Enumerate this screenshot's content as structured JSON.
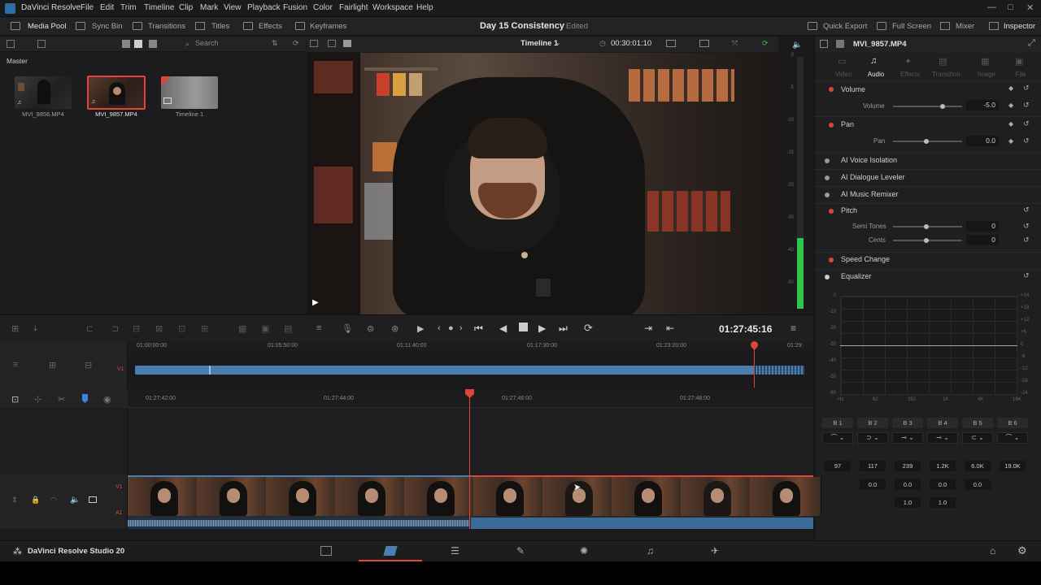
{
  "app": {
    "title": "DaVinci Resolve",
    "brand": "DaVinci Resolve Studio 20"
  },
  "menu": [
    "File",
    "Edit",
    "Trim",
    "Timeline",
    "Clip",
    "Mark",
    "View",
    "Playback",
    "Fusion",
    "Color",
    "Fairlight",
    "Workspace",
    "Help"
  ],
  "toolbar": {
    "left": [
      "Media Pool",
      "Sync Bin",
      "Transitions",
      "Titles",
      "Effects",
      "Keyframes"
    ],
    "project_title": "Day 15 Consistency",
    "project_status": "Edited",
    "right": [
      "Quick Export",
      "Full Screen",
      "Mixer",
      "Inspector"
    ]
  },
  "media_pool": {
    "search_placeholder": "Search",
    "bin": "Master",
    "clips": [
      "MVI_9856.MP4",
      "MVI_9857.MP4",
      "Timeline 1"
    ]
  },
  "viewer": {
    "timeline_name": "Timeline 1",
    "duration": "00:30:01:10",
    "timecode": "01:27:45:16"
  },
  "meter": {
    "scale": [
      "0",
      "-5",
      "-10",
      "-15",
      "-20",
      "-30",
      "-40",
      "-50"
    ],
    "level_pct": 28
  },
  "inspector": {
    "clip_name": "MVI_9857.MP4",
    "tabs": [
      "Video",
      "Audio",
      "Effects",
      "Transition",
      "Image",
      "File"
    ],
    "active_tab": "Audio",
    "sections": {
      "volume": {
        "title": "Volume",
        "label": "Volume",
        "value": "-5.0"
      },
      "pan": {
        "title": "Pan",
        "label": "Pan",
        "value": "0.0"
      },
      "ai_voice": "AI Voice Isolation",
      "ai_dialogue": "AI Dialogue Leveler",
      "ai_music": "AI Music Remixer",
      "pitch": {
        "title": "Pitch",
        "semi_label": "Semi Tones",
        "semi_value": "0",
        "cents_label": "Cents",
        "cents_value": "0"
      },
      "speed": "Speed Change",
      "equalizer": "Equalizer"
    },
    "eq": {
      "left_scale": [
        "0",
        "-10",
        "-20",
        "-30",
        "-40",
        "-50",
        "-60"
      ],
      "right_scale": [
        "+24",
        "+18",
        "+12",
        "+6",
        "0",
        "-6",
        "-12",
        "-18",
        "-24"
      ],
      "freq_labels": [
        "Hz",
        "62",
        "250",
        "1K",
        "4K",
        "16K"
      ],
      "bands": [
        "B 1",
        "B 2",
        "B 3",
        "B 4",
        "B 5",
        "B 6"
      ],
      "freqs": [
        "97",
        "117",
        "239",
        "1.2K",
        "6.0K",
        "19.0K"
      ],
      "gains": [
        "",
        "0.0",
        "0.0",
        "0.0",
        "0.0",
        ""
      ],
      "q": [
        "",
        "",
        "1.0",
        "1.0",
        "",
        ""
      ]
    }
  },
  "timeline": {
    "upper_ruler": [
      "01:00:00:00",
      "01:05:50:00",
      "01:11:40:00",
      "01:17:30:00",
      "01:23:20:00",
      "01:29:"
    ],
    "lower_ruler": [
      "01:27:42:00",
      "01:27:44:00",
      "01:27:46:00",
      "01:27:48:00"
    ],
    "tracks": {
      "video": "V1",
      "audio": "A1"
    }
  },
  "colors": {
    "accent_red": "#e0443a",
    "clip_blue": "#4a7eae",
    "meter_green": "#2fc44a"
  }
}
